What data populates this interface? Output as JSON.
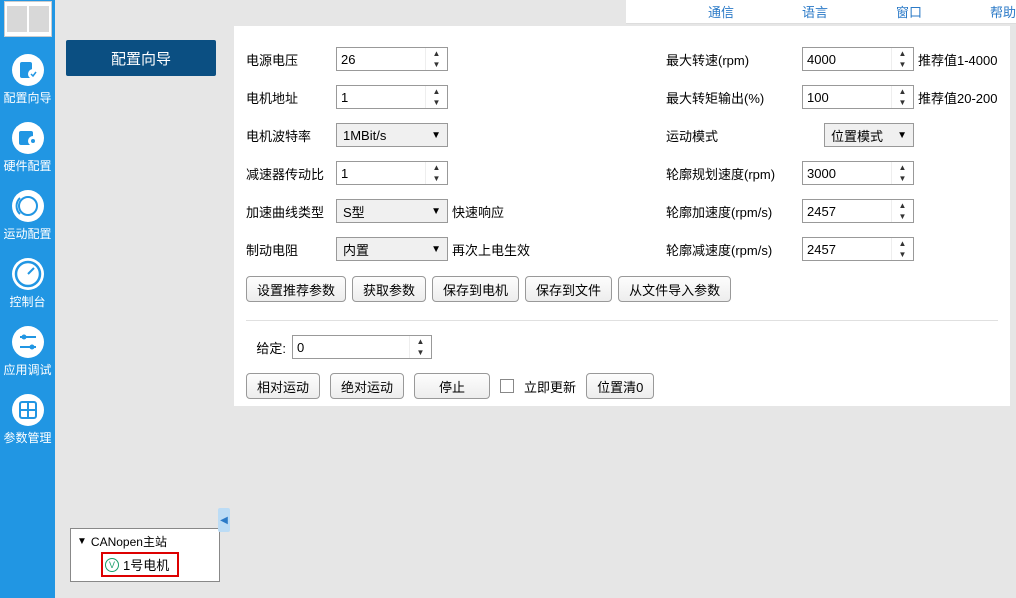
{
  "menu": {
    "comm": "通信",
    "lang": "语言",
    "window": "窗口",
    "help": "帮助"
  },
  "sidebar": {
    "wizard": "配置向导",
    "hardware": "硬件配置",
    "motion": "运动配置",
    "console": "控制台",
    "appdebug": "应用调试",
    "params": "参数管理"
  },
  "wizard_btn": "配置向导",
  "tree": {
    "root": "CANopen主站",
    "child": "1号电机"
  },
  "form": {
    "supply_voltage": {
      "label": "电源电压",
      "value": "26"
    },
    "motor_addr": {
      "label": "电机地址",
      "value": "1"
    },
    "baud": {
      "label": "电机波特率",
      "value": "1MBit/s"
    },
    "gear_ratio": {
      "label": "减速器传动比",
      "value": "1"
    },
    "accel_curve": {
      "label": "加速曲线类型",
      "value": "S型",
      "after": "快速响应"
    },
    "brake": {
      "label": "制动电阻",
      "value": "内置",
      "after": "再次上电生效"
    },
    "max_rpm": {
      "label": "最大转速(rpm)",
      "value": "4000",
      "hint": "推荐值1-4000"
    },
    "max_torque": {
      "label": "最大转矩输出(%)",
      "value": "100",
      "hint": "推荐值20-200"
    },
    "mode": {
      "label": "运动模式",
      "value": "位置模式"
    },
    "profile_speed": {
      "label": "轮廓规划速度(rpm)",
      "value": "3000"
    },
    "profile_accel": {
      "label": "轮廓加速度(rpm/s)",
      "value": "2457"
    },
    "profile_decel": {
      "label": "轮廓减速度(rpm/s)",
      "value": "2457"
    }
  },
  "buttons": {
    "set_default": "设置推荐参数",
    "get_params": "获取参数",
    "save_to_motor": "保存到电机",
    "save_to_file": "保存到文件",
    "load_from_file": "从文件导入参数"
  },
  "setpoint": {
    "label": "给定:",
    "value": "0"
  },
  "controls": {
    "relative": "相对运动",
    "absolute": "绝对运动",
    "stop": "停止",
    "immediate": "立即更新",
    "pos_zero": "位置清0"
  }
}
